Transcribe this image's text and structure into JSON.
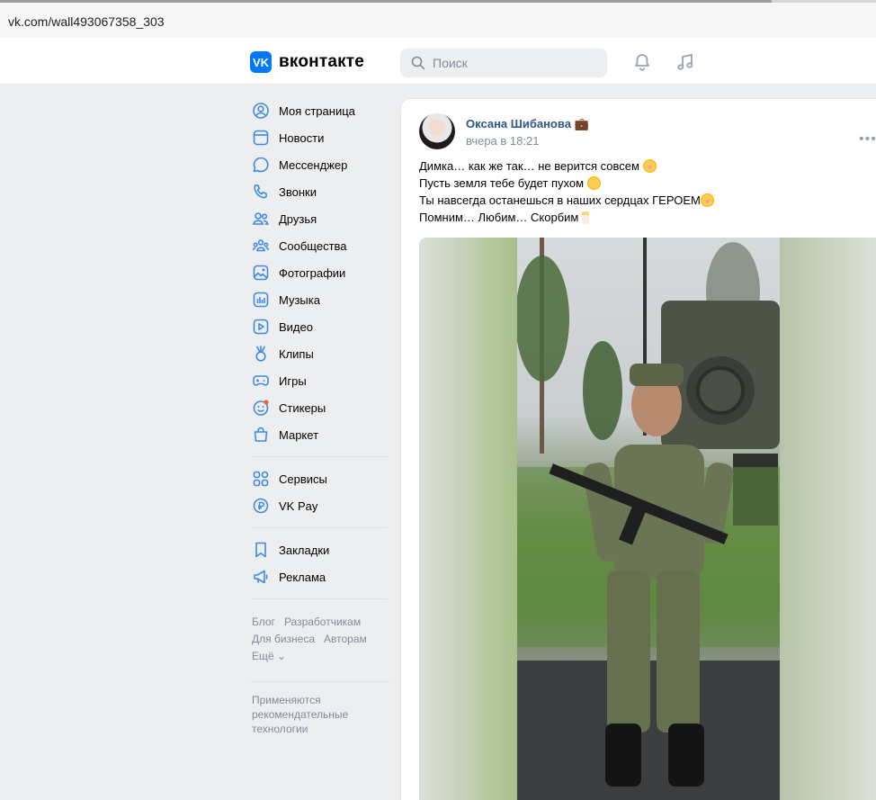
{
  "browser": {
    "url": "vk.com/wall493067358_303"
  },
  "header": {
    "logo_mark": "VK",
    "logo_text": "вконтакте",
    "search_placeholder": "Поиск",
    "icons": [
      "search-icon",
      "bell-icon",
      "music-note-icon"
    ]
  },
  "menu": {
    "items": [
      {
        "label": "Моя страница",
        "icon": "user-icon"
      },
      {
        "label": "Новости",
        "icon": "news-icon"
      },
      {
        "label": "Мессенджер",
        "icon": "chat-icon"
      },
      {
        "label": "Звонки",
        "icon": "phone-icon"
      },
      {
        "label": "Друзья",
        "icon": "friends-icon"
      },
      {
        "label": "Сообщества",
        "icon": "communities-icon"
      },
      {
        "label": "Фотографии",
        "icon": "photo-icon"
      },
      {
        "label": "Музыка",
        "icon": "music-icon"
      },
      {
        "label": "Видео",
        "icon": "video-icon"
      },
      {
        "label": "Клипы",
        "icon": "clips-icon"
      },
      {
        "label": "Игры",
        "icon": "gamepad-icon"
      },
      {
        "label": "Стикеры",
        "icon": "sticker-icon"
      },
      {
        "label": "Маркет",
        "icon": "bag-icon"
      }
    ],
    "group2": [
      {
        "label": "Сервисы",
        "icon": "services-icon"
      },
      {
        "label": "VK Pay",
        "icon": "vkpay-icon"
      }
    ],
    "group3": [
      {
        "label": "Закладки",
        "icon": "bookmark-icon"
      },
      {
        "label": "Реклама",
        "icon": "megaphone-icon"
      }
    ]
  },
  "footer": {
    "blog": "Блог",
    "developers": "Разработчикам",
    "business": "Для бизнеса",
    "authors": "Авторам",
    "more": "Ещё ⌄",
    "reco_note": "Применяются рекомендательные технологии"
  },
  "post": {
    "author": "Оксана Шибанова 💼",
    "time": "вчера в 18:21",
    "more": "•••",
    "lines": [
      "Димка… как же так… не верится совсем",
      "Пусть земля тебе будет пухом",
      "Ты навсегда останешься в наших сердцах ГЕРОЕМ",
      "Помним… Любим… Скорбим"
    ]
  },
  "colors": {
    "accent": "#0077ff",
    "link": "#2a5885",
    "muted": "#818c99",
    "bg": "#edeef0"
  }
}
